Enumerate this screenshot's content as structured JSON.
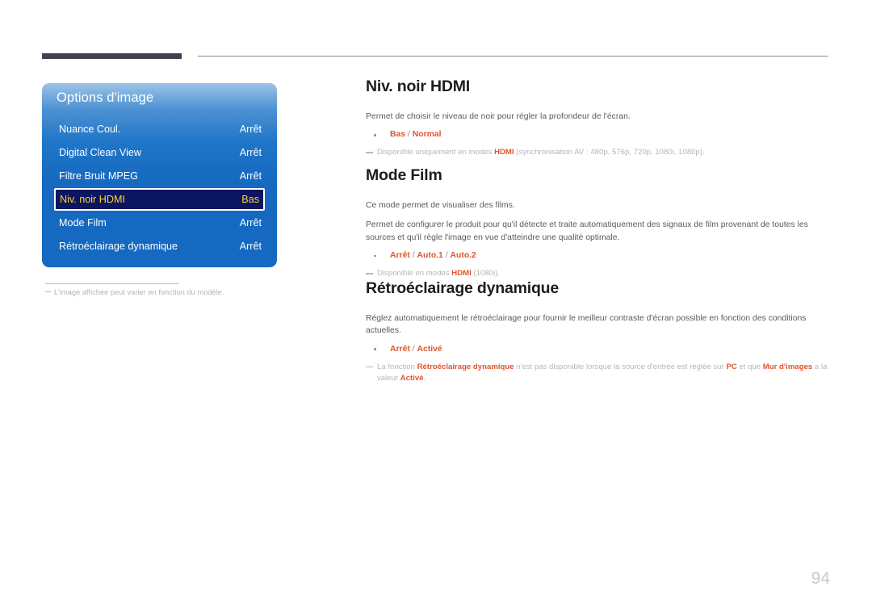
{
  "page": {
    "number": "94"
  },
  "osd": {
    "title": "Options d'image",
    "rows": [
      {
        "label": "Nuance Coul.",
        "value": "Arrêt",
        "selected": false
      },
      {
        "label": "Digital Clean View",
        "value": "Arrêt",
        "selected": false
      },
      {
        "label": "Filtre Bruit MPEG",
        "value": "Arrêt",
        "selected": false
      },
      {
        "label": "Niv. noir HDMI",
        "value": "Bas",
        "selected": true
      },
      {
        "label": "Mode Film",
        "value": "Arrêt",
        "selected": false
      },
      {
        "label": "Rétroéclairage dynamique",
        "value": "Arrêt",
        "selected": false
      }
    ],
    "footnote": "L'image affichée peut varier en fonction du modèle."
  },
  "sections": {
    "niv_noir_hdmi": {
      "title": "Niv. noir HDMI",
      "paragraph": "Permet de choisir le niveau de noir pour régler la profondeur de l'écran.",
      "options": [
        {
          "values": [
            "Bas",
            "Normal"
          ],
          "separator": " / "
        }
      ],
      "note": {
        "lead": "Disponible uniquement en modes ",
        "highlight": "HDMI",
        "tail": " (synchronisation AV : 480p, 576p, 720p, 1080i, 1080p)."
      }
    },
    "mode_film": {
      "title": "Mode Film",
      "paragraph_1": "Ce mode permet de visualiser des films.",
      "paragraph_2": "Permet de configurer le produit pour qu'il détecte et traite automatiquement des signaux de film provenant de toutes les sources et qu'il règle l'image en vue d'atteindre une qualité optimale.",
      "options": [
        {
          "values": [
            "Arrêt",
            "Auto.1",
            "Auto.2"
          ],
          "separator": " / "
        }
      ],
      "note": {
        "lead": "Disponible en modes ",
        "highlight": "HDMI",
        "tail": " (1080i)."
      }
    },
    "retroeclairage_dynamique": {
      "title": "Rétroéclairage dynamique",
      "paragraph": "Réglez automatiquement le rétroéclairage pour fournir le meilleur contraste d'écran possible en fonction des conditions actuelles.",
      "options": [
        {
          "values": [
            "Arrêt",
            "Activé"
          ],
          "separator": " / "
        }
      ],
      "note": {
        "p1": "La fonction ",
        "h1": "Rétroéclairage dynamique",
        "p2": " n'est pas disponible lorsque la source d'entrée est réglée sur ",
        "h2": "PC",
        "p3": " et que ",
        "h3": "Mur d'images",
        "p4": " a la valeur ",
        "h4": "Activé",
        "p5": "."
      }
    }
  },
  "colors": {
    "accent_orange": "#e0542e",
    "osd_blue": "#1569c0",
    "osd_selected_bg": "#0b1560",
    "osd_selected_text": "#ffd23a",
    "header_bar": "#42404f",
    "body_text": "#5b5b5f",
    "note_text": "#b6b6bb"
  }
}
